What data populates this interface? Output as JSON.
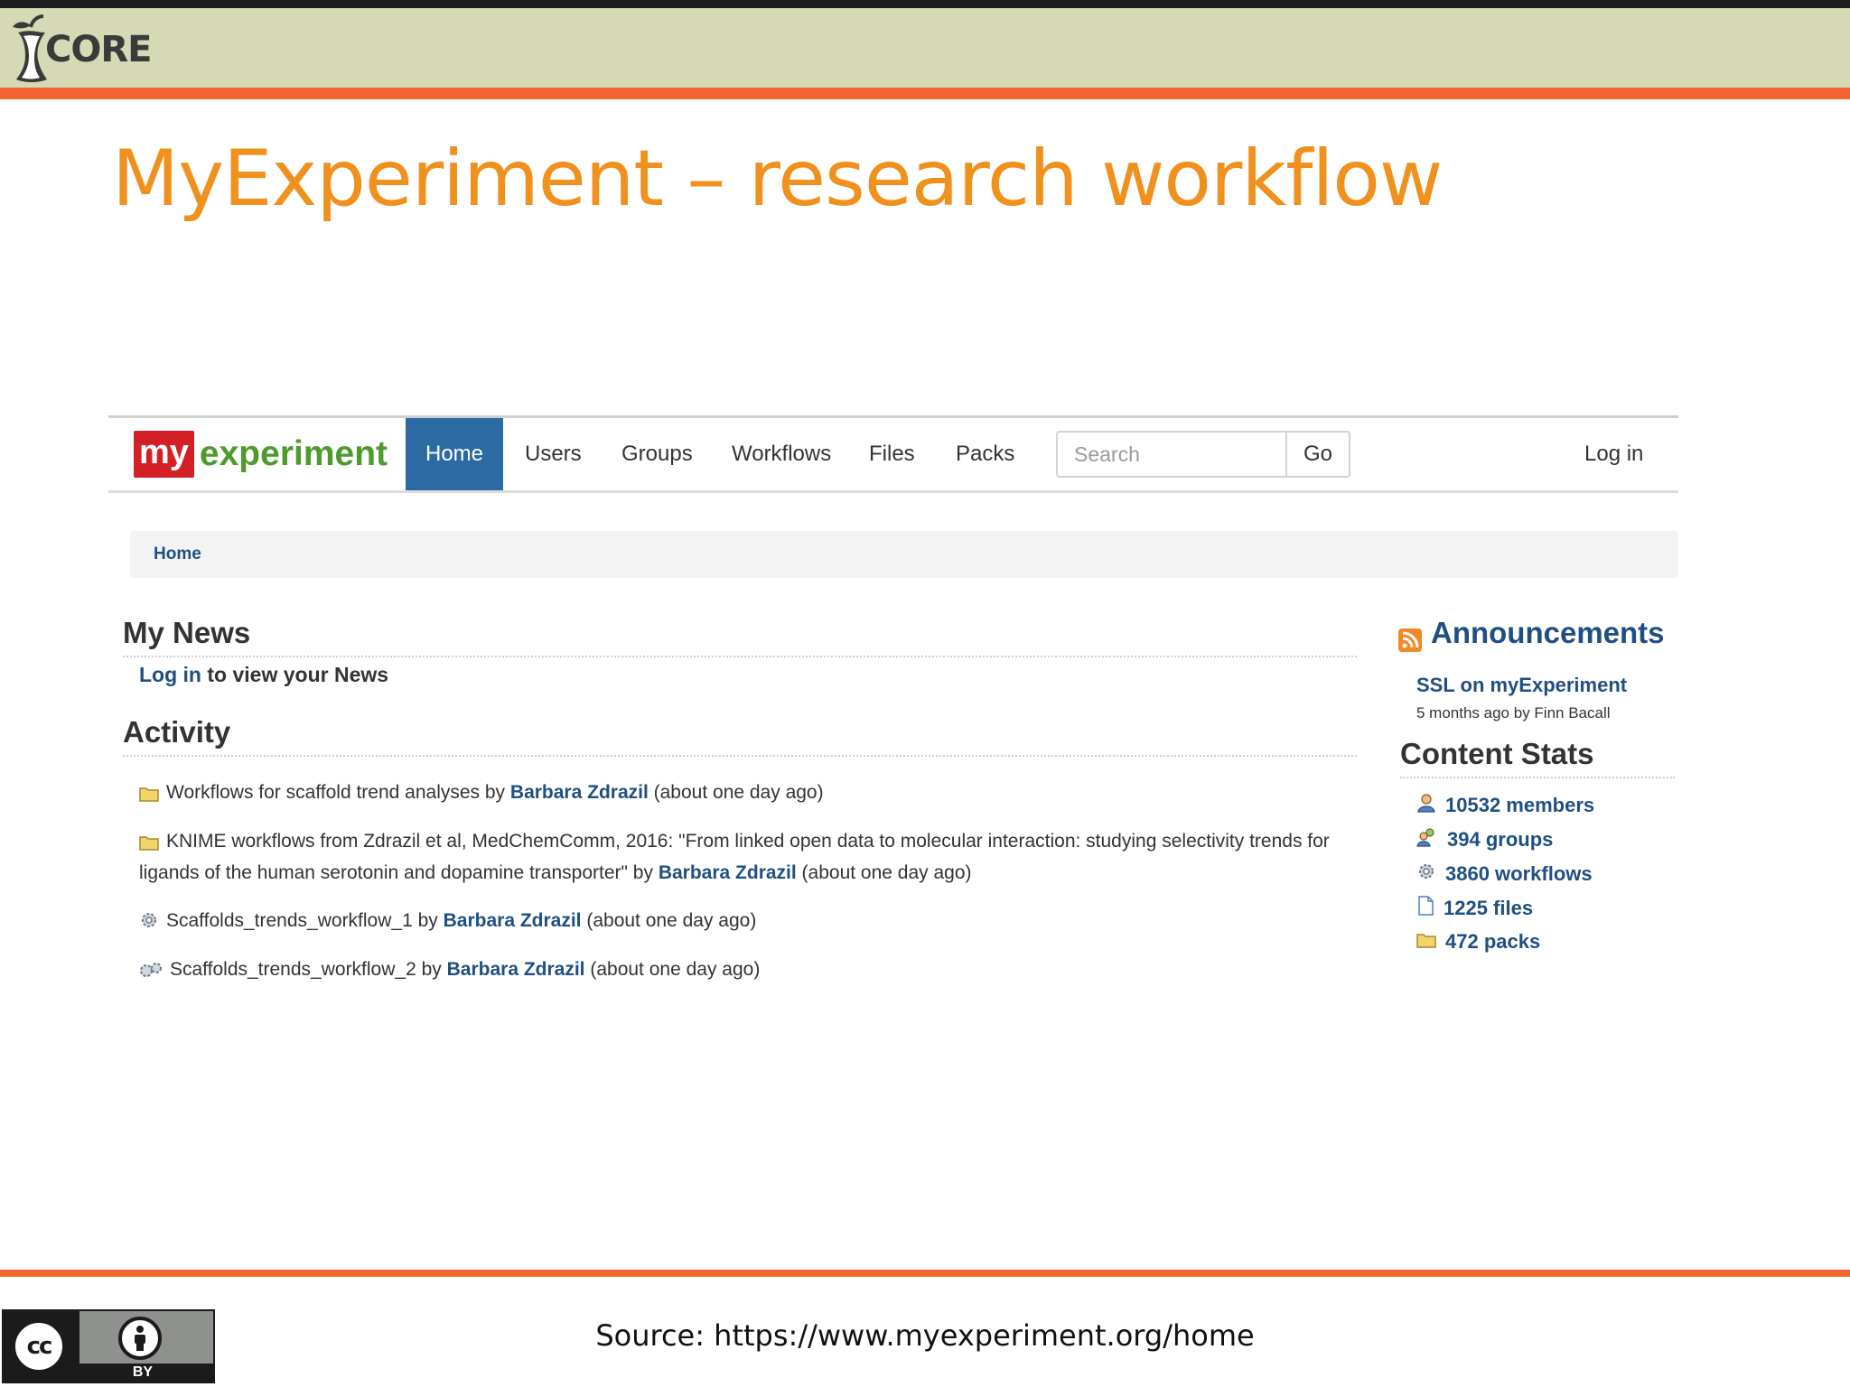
{
  "slide": {
    "logo_text": "CORE",
    "title": "MyExperiment – research workflow",
    "source_text": "Source: https://www.myexperiment.org/home",
    "license_badge": {
      "cc": "cc",
      "by": "BY"
    },
    "colors": {
      "accent_orange": "#f26430",
      "title_orange": "#f0901d",
      "header_bg": "#d5d9b5"
    }
  },
  "myexperiment": {
    "brand": {
      "my": "my",
      "experiment": "experiment"
    },
    "nav": {
      "home": "Home",
      "users": "Users",
      "groups": "Groups",
      "workflows": "Workflows",
      "files": "Files",
      "packs": "Packs",
      "search_placeholder": "Search",
      "go": "Go",
      "login": "Log in"
    },
    "breadcrumb": "Home",
    "news": {
      "heading": "My News",
      "login_link": "Log in",
      "login_rest": " to view your News"
    },
    "activity": {
      "heading": "Activity",
      "items": [
        {
          "icon": "folder-icon",
          "title": "Workflows for scaffold trend analyses",
          "by": " by ",
          "author": "Barbara Zdrazil",
          "time": " (about one day ago)"
        },
        {
          "icon": "folder-icon",
          "title": "KNIME workflows from Zdrazil et al, MedChemComm, 2016: \"From linked open data to molecular interaction: studying selectivity trends for ligands of the human serotonin and dopamine transporter\"",
          "by": " by ",
          "author": "Barbara Zdrazil",
          "time": " (about one day ago)"
        },
        {
          "icon": "gear-icon",
          "title": "Scaffolds_trends_workflow_1",
          "by": " by ",
          "author": "Barbara Zdrazil",
          "time": " (about one day ago)"
        },
        {
          "icon": "gears-icon",
          "title": "Scaffolds_trends_workflow_2",
          "by": " by ",
          "author": "Barbara Zdrazil",
          "time": " (about one day ago)"
        }
      ]
    },
    "announcements": {
      "heading": "Announcements",
      "item_title": "SSL on myExperiment",
      "item_meta": "5 months ago by Finn Bacall"
    },
    "content_stats": {
      "heading": "Content Stats",
      "items": [
        {
          "icon": "user-icon",
          "label": "10532 members"
        },
        {
          "icon": "group-icon",
          "label": "394 groups"
        },
        {
          "icon": "gear-icon",
          "label": "3860 workflows"
        },
        {
          "icon": "file-icon",
          "label": "1225 files"
        },
        {
          "icon": "folder-icon",
          "label": "472 packs"
        }
      ]
    },
    "colors": {
      "brand_red": "#d31f26",
      "brand_green": "#4f9a2c",
      "nav_active": "#2c6aa3",
      "link_blue": "#1f4f82"
    }
  }
}
